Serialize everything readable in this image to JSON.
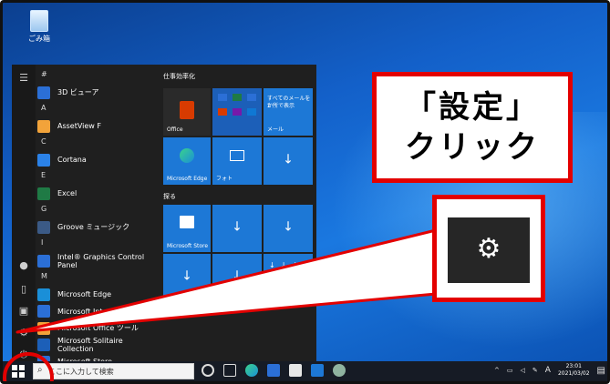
{
  "desktop": {
    "recycle_bin_label": "ごみ箱"
  },
  "start_menu": {
    "app_list": [
      {
        "type": "letter",
        "text": "#"
      },
      {
        "type": "app",
        "text": "3D ビューア",
        "color": "#2b6fd6"
      },
      {
        "type": "letter",
        "text": "A"
      },
      {
        "type": "app",
        "text": "AssetView F",
        "color": "#f2a33a"
      },
      {
        "type": "letter",
        "text": "C"
      },
      {
        "type": "app",
        "text": "Cortana",
        "color": "#2b82e8"
      },
      {
        "type": "letter",
        "text": "E"
      },
      {
        "type": "app",
        "text": "Excel",
        "color": "#1f7a45"
      },
      {
        "type": "letter",
        "text": "G"
      },
      {
        "type": "app",
        "text": "Groove ミュージック",
        "color": "#3b5a86"
      },
      {
        "type": "letter",
        "text": "I"
      },
      {
        "type": "app",
        "text": "Intel® Graphics Control Panel",
        "color": "#2b6fd6"
      },
      {
        "type": "letter",
        "text": "M"
      },
      {
        "type": "app",
        "text": "Microsoft Edge",
        "color": "#1a8fd8"
      },
      {
        "type": "app",
        "text": "Microsoft Intune",
        "color": "#2b6fd6"
      },
      {
        "type": "app",
        "text": "Microsoft Office ツール",
        "color": "#f2a33a"
      },
      {
        "type": "app",
        "text": "Microsoft Solitaire Collection",
        "color": "#1c5fb8"
      },
      {
        "type": "app",
        "text": "Microsoft Store",
        "color": "#2b6fd6"
      }
    ],
    "group1_title": "仕事効率化",
    "group2_title": "探る",
    "tiles": {
      "office": "Office",
      "mail_line1": "すべてのメールを1",
      "mail_line2": "か所で表示",
      "mail": "メール",
      "edge": "Microsoft Edge",
      "photos": "フォト",
      "store": "Microsoft Store"
    }
  },
  "taskbar": {
    "search_placeholder": "ここに入力して検索",
    "clock_time": "23:01",
    "clock_date": "2021/03/02",
    "ime": "A"
  },
  "callout": {
    "line1": "「設定」",
    "line2": "クリック"
  },
  "icons": {
    "settings": "gear-icon",
    "start": "windows-logo-icon",
    "search": "search-icon",
    "download": "download-arrow-icon"
  },
  "colors": {
    "highlight": "#e30000",
    "tile_blue": "#1d78d6",
    "start_bg": "#1f1f1f"
  }
}
